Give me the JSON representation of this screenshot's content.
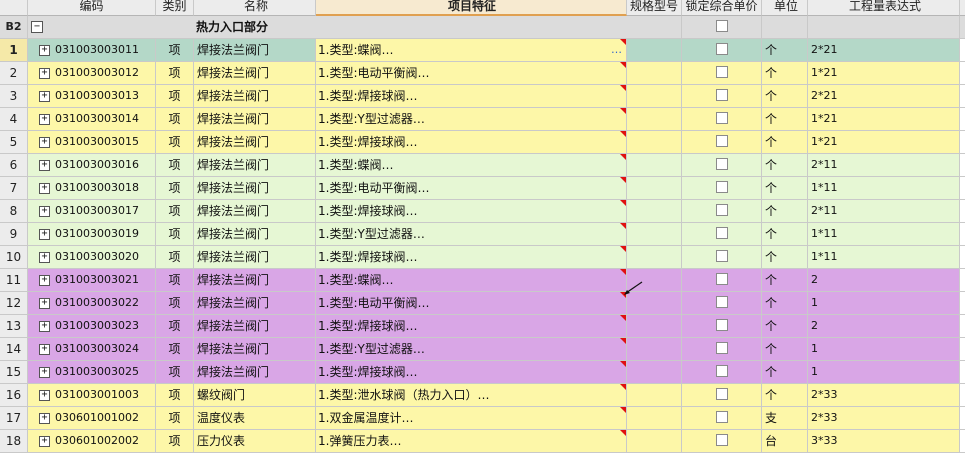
{
  "header": {
    "num": "",
    "code": "编码",
    "type": "类别",
    "name": "名称",
    "feature": "项目特征",
    "spec": "规格型号",
    "lock": "锁定综合单价",
    "unit": "单位",
    "expr": "工程量表达式"
  },
  "group": {
    "num": "B2",
    "title": "热力入口部分"
  },
  "colors": {
    "selected_row": "#b4d8c8",
    "yellow": "#fdf7a8",
    "green": "#e6f7d4",
    "purple": "#d9a6e6"
  },
  "rows": [
    {
      "num": "1",
      "code": "031003003011",
      "type": "项",
      "name": "焊接法兰阀门",
      "feature": "1.类型:蝶阀…",
      "unit": "个",
      "expr": "2*21",
      "color": "selected",
      "dots": "…"
    },
    {
      "num": "2",
      "code": "031003003012",
      "type": "项",
      "name": "焊接法兰阀门",
      "feature": "1.类型:电动平衡阀…",
      "unit": "个",
      "expr": "1*21",
      "color": "yellow"
    },
    {
      "num": "3",
      "code": "031003003013",
      "type": "项",
      "name": "焊接法兰阀门",
      "feature": "1.类型:焊接球阀…",
      "unit": "个",
      "expr": "2*21",
      "color": "yellow"
    },
    {
      "num": "4",
      "code": "031003003014",
      "type": "项",
      "name": "焊接法兰阀门",
      "feature": "1.类型:Y型过滤器…",
      "unit": "个",
      "expr": "1*21",
      "color": "yellow"
    },
    {
      "num": "5",
      "code": "031003003015",
      "type": "项",
      "name": "焊接法兰阀门",
      "feature": "1.类型:焊接球阀…",
      "unit": "个",
      "expr": "1*21",
      "color": "yellow"
    },
    {
      "num": "6",
      "code": "031003003016",
      "type": "项",
      "name": "焊接法兰阀门",
      "feature": "1.类型:蝶阀…",
      "unit": "个",
      "expr": "2*11",
      "color": "green"
    },
    {
      "num": "7",
      "code": "031003003018",
      "type": "项",
      "name": "焊接法兰阀门",
      "feature": "1.类型:电动平衡阀…",
      "unit": "个",
      "expr": "1*11",
      "color": "green"
    },
    {
      "num": "8",
      "code": "031003003017",
      "type": "项",
      "name": "焊接法兰阀门",
      "feature": "1.类型:焊接球阀…",
      "unit": "个",
      "expr": "2*11",
      "color": "green"
    },
    {
      "num": "9",
      "code": "031003003019",
      "type": "项",
      "name": "焊接法兰阀门",
      "feature": "1.类型:Y型过滤器…",
      "unit": "个",
      "expr": "1*11",
      "color": "green"
    },
    {
      "num": "10",
      "code": "031003003020",
      "type": "项",
      "name": "焊接法兰阀门",
      "feature": "1.类型:焊接球阀…",
      "unit": "个",
      "expr": "1*11",
      "color": "green"
    },
    {
      "num": "11",
      "code": "031003003021",
      "type": "项",
      "name": "焊接法兰阀门",
      "feature": "1.类型:蝶阀…",
      "unit": "个",
      "expr": "2",
      "color": "purple"
    },
    {
      "num": "12",
      "code": "031003003022",
      "type": "项",
      "name": "焊接法兰阀门",
      "feature": "1.类型:电动平衡阀…",
      "unit": "个",
      "expr": "1",
      "color": "purple"
    },
    {
      "num": "13",
      "code": "031003003023",
      "type": "项",
      "name": "焊接法兰阀门",
      "feature": "1.类型:焊接球阀…",
      "unit": "个",
      "expr": "2",
      "color": "purple"
    },
    {
      "num": "14",
      "code": "031003003024",
      "type": "项",
      "name": "焊接法兰阀门",
      "feature": "1.类型:Y型过滤器…",
      "unit": "个",
      "expr": "1",
      "color": "purple"
    },
    {
      "num": "15",
      "code": "031003003025",
      "type": "项",
      "name": "焊接法兰阀门",
      "feature": "1.类型:焊接球阀…",
      "unit": "个",
      "expr": "1",
      "color": "purple"
    },
    {
      "num": "16",
      "code": "031003001003",
      "type": "项",
      "name": "螺纹阀门",
      "feature": "1.类型:泄水球阀（热力入口）…",
      "unit": "个",
      "expr": "2*33",
      "color": "yellow"
    },
    {
      "num": "17",
      "code": "030601001002",
      "type": "项",
      "name": "温度仪表",
      "feature": "1.双金属温度计…",
      "unit": "支",
      "expr": "2*33",
      "color": "yellow"
    },
    {
      "num": "18",
      "code": "030601002002",
      "type": "项",
      "name": "压力仪表",
      "feature": "1.弹簧压力表…",
      "unit": "台",
      "expr": "3*33",
      "color": "yellow"
    }
  ]
}
